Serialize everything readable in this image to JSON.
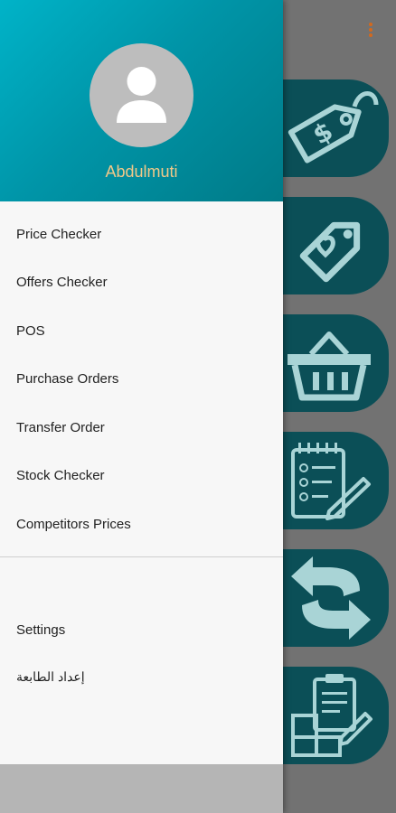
{
  "user": {
    "name": "Abdulmuti"
  },
  "menu": {
    "items": [
      {
        "label": "Price Checker"
      },
      {
        "label": "Offers Checker"
      },
      {
        "label": "POS"
      },
      {
        "label": "Purchase Orders"
      },
      {
        "label": "Transfer Order"
      },
      {
        "label": "Stock Checker"
      },
      {
        "label": "Competitors Prices"
      }
    ],
    "settings_label": "Settings",
    "printer_settings_label": "إعداد الطابعة"
  },
  "background_tiles": [
    {
      "icon": "price-tag-dollar-icon"
    },
    {
      "icon": "offer-tag-heart-icon"
    },
    {
      "icon": "shopping-basket-icon"
    },
    {
      "icon": "checklist-clipboard-icon"
    },
    {
      "icon": "transfer-arrows-icon"
    },
    {
      "icon": "inventory-clipboard-boxes-icon"
    }
  ],
  "colors": {
    "header_accent": "#00a3b6",
    "username": "#f1c888",
    "tile": "#0b4f57",
    "overflow_dots": "#d2691e"
  }
}
